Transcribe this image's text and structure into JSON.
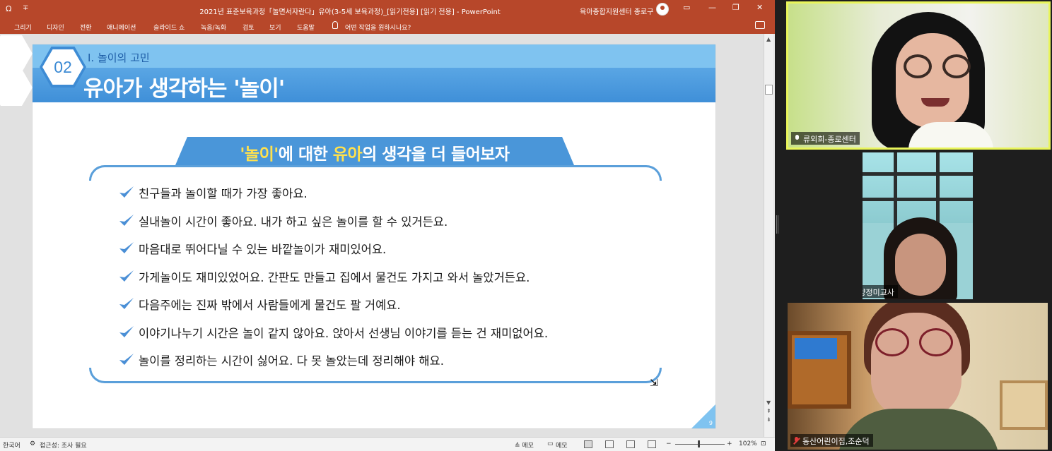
{
  "window": {
    "quick_access_icon": "Ω",
    "quick_access_more": "∓",
    "title": "2021년 표준보육과정「놀면서자란다」유아(3-5세 보육과정)_[읽기전용] [읽기 전용] - PowerPoint",
    "user": "육아종합지원센터 종로구",
    "btn_ribbon_display": "▭",
    "btn_min": "—",
    "btn_max": "❐",
    "btn_close": "✕"
  },
  "ribbon": {
    "tabs": [
      "그리기",
      "디자인",
      "전환",
      "애니메이션",
      "슬라이드 쇼",
      "녹음/녹화",
      "검토",
      "보기",
      "도움말"
    ],
    "tell_me": "어떤 작업을 원하시나요?"
  },
  "slide": {
    "badge_number": "02",
    "section": "Ⅰ. 놀이의 고민",
    "title": "유아가 생각하는 '놀이'",
    "banner": {
      "part1": "'놀이'",
      "part2": "에 대한 ",
      "part3": "유아",
      "part4": "의 생각을 더 들어보자"
    },
    "items": [
      "친구들과 놀이할 때가 가장 좋아요.",
      "실내놀이 시간이 좋아요. 내가 하고 싶은 놀이를 할 수 있거든요.",
      "마음대로 뛰어다닐 수 있는 바깥놀이가 재미있어요.",
      "가게놀이도 재미있었어요. 간판도 만들고 집에서 물건도 가지고 와서 놀았거든요.",
      "다음주에는 진짜 밖에서 사람들에게 물건도 팔 거예요.",
      "이야기나누기 시간은 놀이 같지 않아요. 앉아서 선생님 이야기를 듣는 건 재미없어요.",
      "놀이를 정리하는 시간이 싫어요. 다 못 놀았는데 정리해야 해요."
    ],
    "page_number": "9",
    "colors": {
      "primary": "#3d8bd4",
      "light": "#7fc3f0",
      "highlight": "#ffe14d"
    }
  },
  "statusbar": {
    "language": "한국어",
    "accessibility": "접근성: 조사 필요",
    "notes": "≙ 메모",
    "comments": "메모",
    "zoom_minus": "−",
    "zoom_plus": "+",
    "zoom": "102%"
  },
  "video": {
    "participants": [
      {
        "name": "류외희-종로센터",
        "muted": false,
        "active_speaker": true
      },
      {
        "name": "시립 빛나는 하남 양정미교사",
        "muted": true,
        "active_speaker": false
      },
      {
        "name": "동산어린이집,조순덕",
        "muted": true,
        "active_speaker": false
      }
    ]
  }
}
